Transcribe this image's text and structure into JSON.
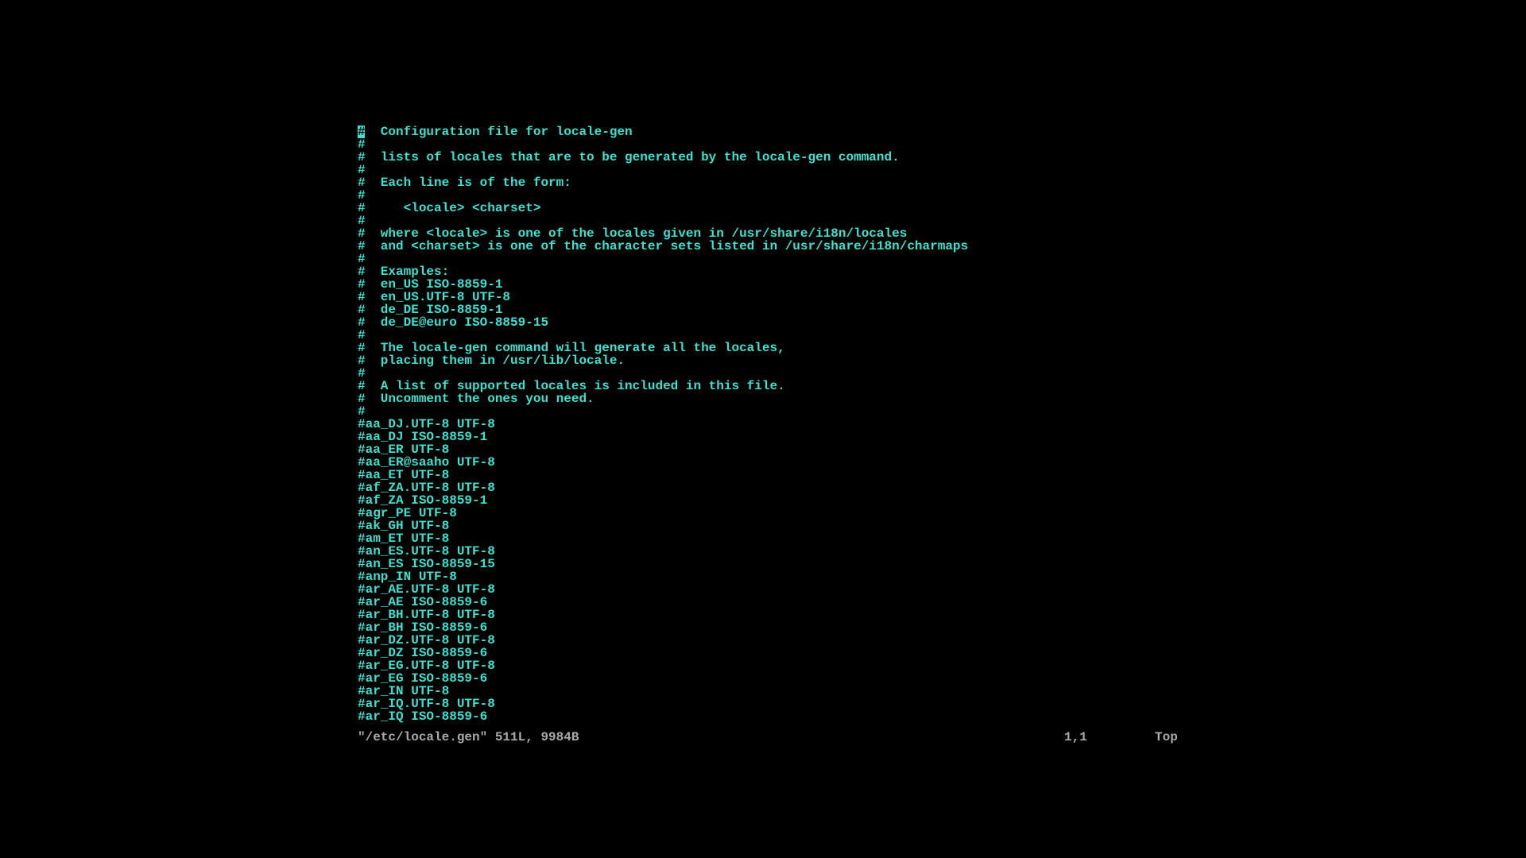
{
  "editor": {
    "lines": [
      "#  Configuration file for locale-gen",
      "#",
      "#  lists of locales that are to be generated by the locale-gen command.",
      "#",
      "#  Each line is of the form:",
      "#",
      "#     <locale> <charset>",
      "#",
      "#  where <locale> is one of the locales given in /usr/share/i18n/locales",
      "#  and <charset> is one of the character sets listed in /usr/share/i18n/charmaps",
      "#",
      "#  Examples:",
      "#  en_US ISO-8859-1",
      "#  en_US.UTF-8 UTF-8",
      "#  de_DE ISO-8859-1",
      "#  de_DE@euro ISO-8859-15",
      "#",
      "#  The locale-gen command will generate all the locales,",
      "#  placing them in /usr/lib/locale.",
      "#",
      "#  A list of supported locales is included in this file.",
      "#  Uncomment the ones you need.",
      "#",
      "#aa_DJ.UTF-8 UTF-8",
      "#aa_DJ ISO-8859-1",
      "#aa_ER UTF-8",
      "#aa_ER@saaho UTF-8",
      "#aa_ET UTF-8",
      "#af_ZA.UTF-8 UTF-8",
      "#af_ZA ISO-8859-1",
      "#agr_PE UTF-8",
      "#ak_GH UTF-8",
      "#am_ET UTF-8",
      "#an_ES.UTF-8 UTF-8",
      "#an_ES ISO-8859-15",
      "#anp_IN UTF-8",
      "#ar_AE.UTF-8 UTF-8",
      "#ar_AE ISO-8859-6",
      "#ar_BH.UTF-8 UTF-8",
      "#ar_BH ISO-8859-6",
      "#ar_DZ.UTF-8 UTF-8",
      "#ar_DZ ISO-8859-6",
      "#ar_EG.UTF-8 UTF-8",
      "#ar_EG ISO-8859-6",
      "#ar_IN UTF-8",
      "#ar_IQ.UTF-8 UTF-8",
      "#ar_IQ ISO-8859-6"
    ]
  },
  "status": {
    "file": "\"/etc/locale.gen\" 511L, 9984B",
    "position": "1,1",
    "scroll": "Top"
  },
  "cursor": {
    "char": "#"
  }
}
